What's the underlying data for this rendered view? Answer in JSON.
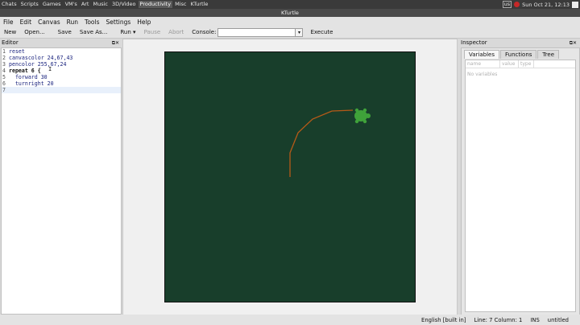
{
  "system_panel": {
    "menus": [
      "Chats",
      "Scripts",
      "Games",
      "VM's",
      "Art",
      "Music",
      "3D/Video",
      "Productivity",
      "Misc",
      "KTurtle"
    ],
    "active_menu": "Productivity",
    "keyboard": "us",
    "clock": "Sun Oct 21, 12:13"
  },
  "window": {
    "title": "KTurtle"
  },
  "menubar": [
    "File",
    "Edit",
    "Canvas",
    "Run",
    "Tools",
    "Settings",
    "Help"
  ],
  "toolbar": {
    "new": "New",
    "open": "Open...",
    "save": "Save",
    "save_as": "Save As...",
    "run": "Run",
    "pause": "Pause",
    "abort": "Abort",
    "console_label": "Console:",
    "console_value": "",
    "execute": "Execute"
  },
  "editor": {
    "title": "Editor",
    "lines": [
      {
        "n": "1",
        "text": "reset"
      },
      {
        "n": "2",
        "text": "canvascolor 24,67,43"
      },
      {
        "n": "3",
        "text": "pencolor 255,67,24"
      },
      {
        "n": "4",
        "text": "repeat 6 {"
      },
      {
        "n": "5",
        "text": "  forward 30"
      },
      {
        "n": "6",
        "text": "  turnright 20"
      },
      {
        "n": "7",
        "text": ""
      }
    ]
  },
  "canvas": {
    "background_color": "#183e2b",
    "pen_color": "#b65a18",
    "turtle_color": "#3fa23a"
  },
  "inspector": {
    "title": "Inspector",
    "tabs": [
      "Variables",
      "Functions",
      "Tree"
    ],
    "active_tab": "Variables",
    "columns": [
      "name",
      "value",
      "type"
    ],
    "empty_text": "No variables"
  },
  "statusbar": {
    "language": "English [built in]",
    "position": "Line: 7 Column: 1",
    "mode": "INS",
    "file": "untitled"
  }
}
